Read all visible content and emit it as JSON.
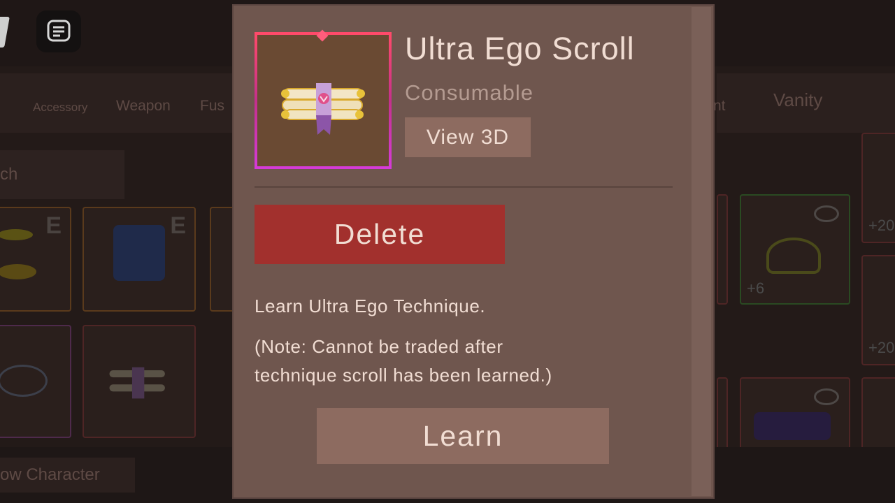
{
  "background": {
    "tabs": [
      "Accessory",
      "Weapon",
      "Fus",
      "nt",
      "Vanity"
    ],
    "search_text": "ch",
    "card_badges": {
      "equipped_1": "E",
      "equipped_2": "E",
      "boost_green": "+6",
      "boost_right_1": "+20",
      "boost_right_2": "+20"
    },
    "bottom_button": "ow Character"
  },
  "modal": {
    "item_name": "Ultra Ego Scroll",
    "item_type": "Consumable",
    "view_3d_label": "View 3D",
    "delete_label": "Delete",
    "description": "Learn Ultra Ego Technique.",
    "note_line1": "(Note: Cannot be traded after",
    "note_line2": "technique scroll has been learned.)",
    "learn_label": "Learn",
    "rarity_color": "#d5347a"
  },
  "icons": [
    "chat-icon",
    "roblox-menu-icon",
    "scroll-item-icon",
    "hidden-eye-icon"
  ]
}
